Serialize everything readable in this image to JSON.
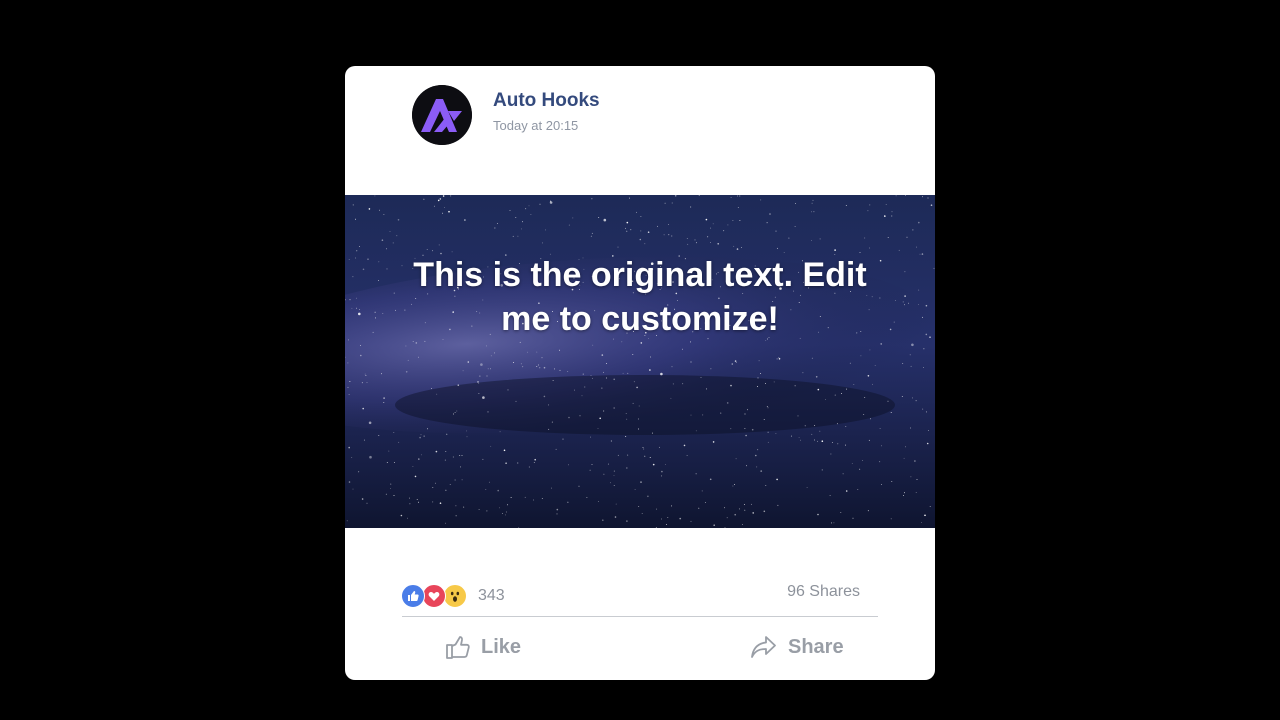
{
  "post": {
    "author": "Auto Hooks",
    "timestamp": "Today at 20:15",
    "media_text": "This is the original text. Edit me to customize!"
  },
  "reactions": {
    "icons": [
      "thumbs-up-icon",
      "heart-icon",
      "wow-face-icon"
    ],
    "count": "343",
    "shares": "96 Shares"
  },
  "actions": {
    "like_label": "Like",
    "share_label": "Share"
  },
  "colors": {
    "author": "#344a7d",
    "logo_accent": "#8b5cf6",
    "like_reaction": "#4a7de8",
    "love_reaction": "#e8455a",
    "wow_reaction": "#f7c948",
    "muted_text": "#8d929b"
  }
}
